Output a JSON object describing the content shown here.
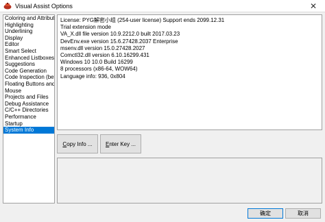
{
  "window": {
    "title": "Visual Assist Options",
    "close_glyph": "✕"
  },
  "sidebar": {
    "items": [
      {
        "label": "Coloring and Attribute",
        "selected": false
      },
      {
        "label": "Highlighting",
        "selected": false
      },
      {
        "label": "Underlining",
        "selected": false
      },
      {
        "label": "Display",
        "selected": false
      },
      {
        "label": "Editor",
        "selected": false
      },
      {
        "label": "Smart Select",
        "selected": false
      },
      {
        "label": "Enhanced Listboxes",
        "selected": false
      },
      {
        "label": "Suggestions",
        "selected": false
      },
      {
        "label": "Code Generation",
        "selected": false
      },
      {
        "label": "Code Inspection (beta)",
        "selected": false
      },
      {
        "label": "Floating Buttons and Ic",
        "selected": false
      },
      {
        "label": "Mouse",
        "selected": false
      },
      {
        "label": "Projects and Files",
        "selected": false
      },
      {
        "label": "Debug Assistance",
        "selected": false
      },
      {
        "label": "C/C++ Directories",
        "selected": false
      },
      {
        "label": "Performance",
        "selected": false
      },
      {
        "label": "Startup",
        "selected": false
      },
      {
        "label": "System Info",
        "selected": true
      }
    ]
  },
  "info": {
    "lines": [
      "License: PYG解密小组 (254-user license) Support ends 2099.12.31",
      "Trial extension mode",
      "VA_X.dll file version 10.9.2212.0  built 2017.03.23",
      "DevEnv.exe version 15.6.27428.2037 Enterprise",
      "msenv.dll version 15.0.27428.2027",
      "Comctl32.dll version 6.10.16299.431",
      "Windows 10 10.0 Build 16299",
      "8 processors (x86-64, WOW64)",
      "Language info: 936, 0x804"
    ]
  },
  "buttons": {
    "copy_info": {
      "underlined": "C",
      "rest": "opy Info ..."
    },
    "enter_key": {
      "underlined": "E",
      "rest": "nter Key ..."
    },
    "ok": "确定",
    "cancel": "取消"
  },
  "icons": {
    "app": "visual-assist-icon",
    "close": "close-icon"
  }
}
